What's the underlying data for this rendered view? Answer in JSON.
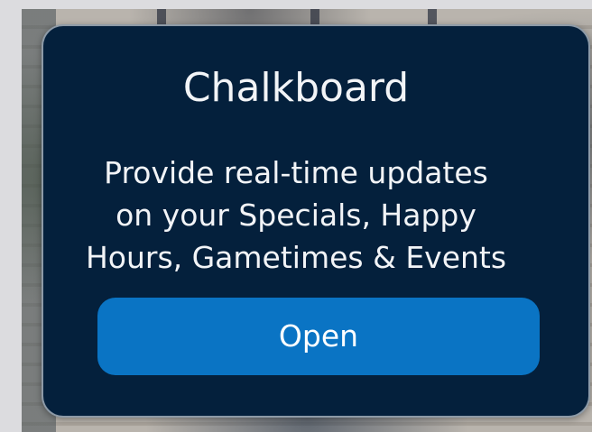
{
  "popup": {
    "title": "Chalkboard",
    "description_lines": [
      "Provide real-time updates",
      "on your Specials, Happy",
      "Hours, Gametimes & Events"
    ],
    "open_label": "Open"
  },
  "colors": {
    "card_background": "#04203c",
    "button_background": "#0a74c4",
    "text": "#f2f4f7"
  }
}
